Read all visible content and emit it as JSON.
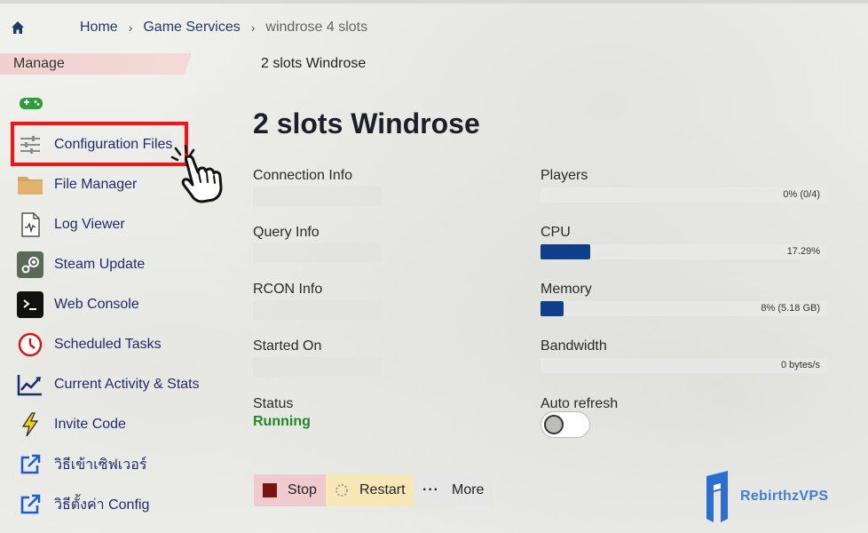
{
  "breadcrumb": {
    "home": "Home",
    "game_services": "Game Services",
    "current": "windrose 4 slots"
  },
  "manage_label": "Manage",
  "subtitle": "2 slots Windrose",
  "sidebar": {
    "items": [
      {
        "label": "Configuration Files",
        "icon": "sliders-icon"
      },
      {
        "label": "File Manager",
        "icon": "folder-icon"
      },
      {
        "label": "Log Viewer",
        "icon": "log-file-icon"
      },
      {
        "label": "Steam Update",
        "icon": "steam-icon"
      },
      {
        "label": "Web Console",
        "icon": "terminal-icon"
      },
      {
        "label": "Scheduled Tasks",
        "icon": "clock-icon"
      },
      {
        "label": "Current Activity & Stats",
        "icon": "chart-icon"
      },
      {
        "label": "Invite Code",
        "icon": "lightning-icon"
      },
      {
        "label": "วิธีเข้าเซิฟเวอร์",
        "icon": "external-link-icon"
      },
      {
        "label": "วิธีตั้งค่า Config",
        "icon": "external-link-icon"
      }
    ]
  },
  "main": {
    "title": "2 slots Windrose",
    "connection_info_label": "Connection Info",
    "query_info_label": "Query Info",
    "rcon_info_label": "RCON Info",
    "started_on_label": "Started On",
    "status_label": "Status",
    "status_value": "Running",
    "players_label": "Players",
    "players_value": "0% (0/4)",
    "players_fraction": 0,
    "cpu_label": "CPU",
    "cpu_value": "17.29%",
    "cpu_fraction": 0.1729,
    "memory_label": "Memory",
    "memory_value": "8% (5.18 GB)",
    "memory_fraction": 0.08,
    "bandwidth_label": "Bandwidth",
    "bandwidth_value": "0 bytes/s",
    "bandwidth_fraction": 0,
    "auto_refresh_label": "Auto refresh",
    "auto_refresh_on": false
  },
  "actions": {
    "stop": "Stop",
    "restart": "Restart",
    "more": "More"
  },
  "logo_text": "RebirthzVPS",
  "colors": {
    "link": "#232a6e",
    "bar_fill": "#0f3f8a",
    "status_running": "#1f8a1f",
    "highlight": "#ff1010",
    "stop_bg": "#f0c8cd",
    "restart_bg": "#fae8b4"
  }
}
